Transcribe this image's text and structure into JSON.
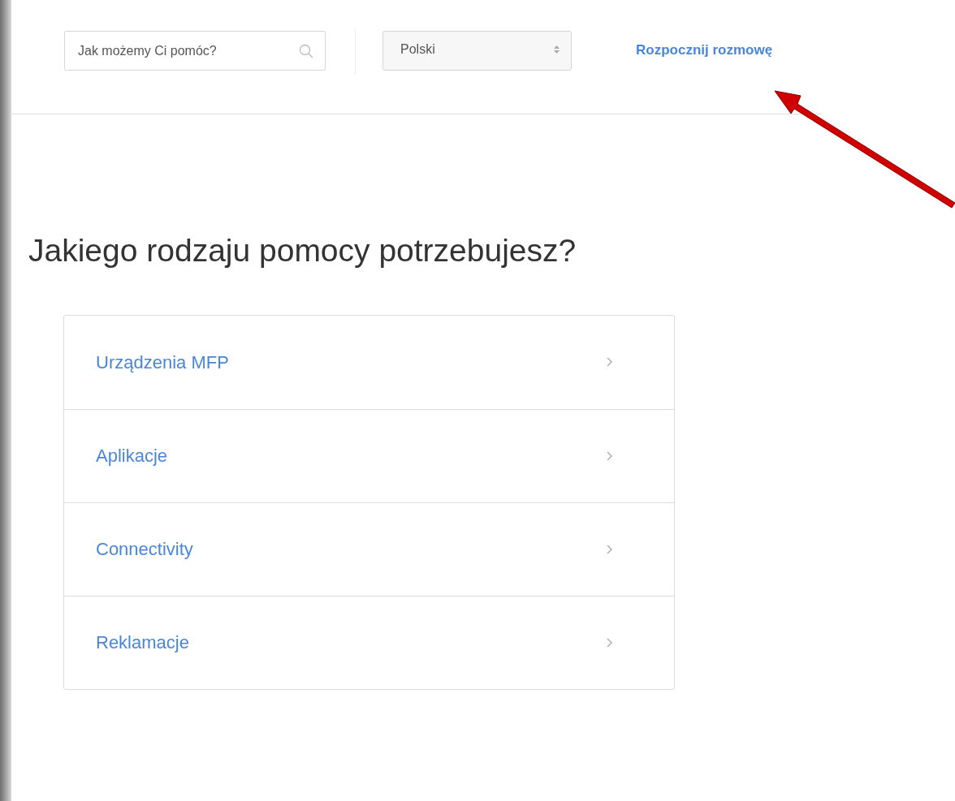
{
  "header": {
    "search": {
      "placeholder": "Jak możemy Ci pomóc?"
    },
    "language_select": {
      "value": "Polski"
    },
    "chat_link": "Rozpocznij rozmowę"
  },
  "heading": "Jakiego rodzaju pomocy potrzebujesz?",
  "categories": [
    {
      "label": "Urządzenia MFP"
    },
    {
      "label": "Aplikacje"
    },
    {
      "label": "Connectivity"
    },
    {
      "label": "Reklamacje"
    }
  ]
}
